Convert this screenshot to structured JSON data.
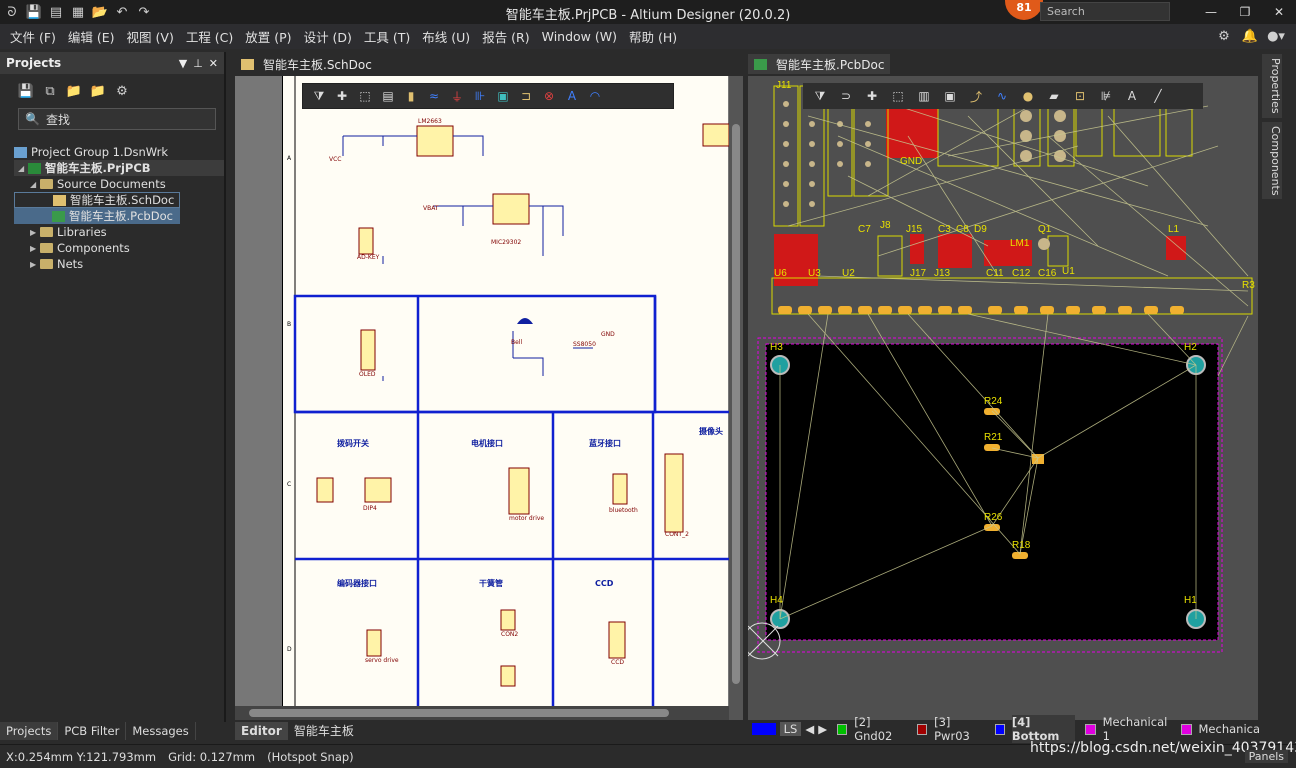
{
  "window": {
    "title": "智能车主板.PrjPCB - Altium Designer (20.0.2)",
    "notifications": "81",
    "search_placeholder": "Search"
  },
  "menu": [
    "文件 (F)",
    "编辑 (E)",
    "视图 (V)",
    "工程 (C)",
    "放置 (P)",
    "设计 (D)",
    "工具 (T)",
    "布线 (U)",
    "报告 (R)",
    "Window (W)",
    "帮助 (H)"
  ],
  "projects_panel": {
    "title": "Projects",
    "search_label": "查找",
    "tree": {
      "group": "Project Group 1.DsnWrk",
      "project": "智能车主板.PrjPCB",
      "source_documents": "Source Documents",
      "sch_doc": "智能车主板.SchDoc",
      "pcb_doc": "智能车主板.PcbDoc",
      "libraries": "Libraries",
      "components": "Components",
      "nets": "Nets"
    },
    "tabs": [
      "Projects",
      "PCB Filter",
      "Messages"
    ]
  },
  "editor": {
    "sch_tab": "智能车主板.SchDoc",
    "pcb_tab": "智能车主板.PcbDoc",
    "bottom_tabs": [
      "Editor",
      "智能车主板"
    ],
    "side_panels": [
      "Properties",
      "Components"
    ]
  },
  "layers": {
    "ls": "LS",
    "items": [
      {
        "name": "[2] Gnd02",
        "color": "#00c000"
      },
      {
        "name": "[3] Pwr03",
        "color": "#a00000"
      },
      {
        "name": "[4] Bottom",
        "color": "#0000ff"
      },
      {
        "name": "Mechanical 1",
        "color": "#e000e0"
      },
      {
        "name": "Mechanica",
        "color": "#e000e0"
      }
    ]
  },
  "status": {
    "coords": "X:0.254mm Y:121.793mm",
    "grid": "Grid: 0.127mm",
    "snap": "(Hotspot Snap)",
    "panels": "Panels"
  },
  "watermark": "https://blog.csdn.net/weixin_40379143",
  "schematic_labels": [
    "拨码开关",
    "电机接口",
    "蓝牙接口",
    "摄像头",
    "编码器接口",
    "干簧管",
    "CCD",
    "GND",
    "VCC",
    "VBAT",
    "LM2663",
    "MIC29302",
    "OLED",
    "AD-KEY",
    "motor drive",
    "bluetooth",
    "CONT_2",
    "servo drive",
    "CON2",
    "CCD",
    "SS8050",
    "Bell",
    "DIP4"
  ],
  "pcb_labels": [
    "J11",
    "GND",
    "U6",
    "U3",
    "U2",
    "J8",
    "C3",
    "C8",
    "D9",
    "LM1",
    "Q1",
    "L1",
    "C7",
    "J15",
    "J17",
    "J13",
    "C11",
    "C12",
    "C16",
    "U1",
    "R3",
    "H3",
    "H2",
    "H4",
    "H1",
    "R24",
    "R21",
    "R26",
    "R18"
  ]
}
